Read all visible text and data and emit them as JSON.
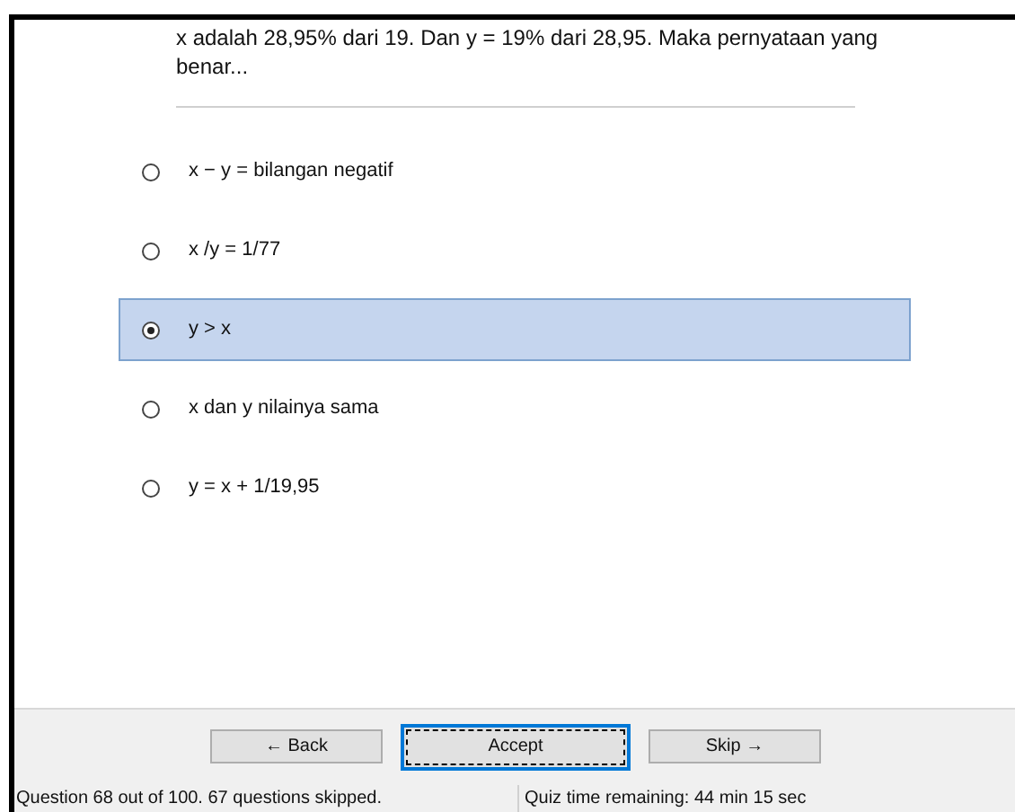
{
  "question": "x adalah 28,95% dari 19.  Dan y = 19% dari 28,95. Maka pernyataan yang benar...",
  "options": [
    {
      "label": "x − y = bilangan negatif",
      "selected": false
    },
    {
      "label": "x /y = 1/77",
      "selected": false
    },
    {
      "label": "y > x",
      "selected": true
    },
    {
      "label": "x dan y nilainya sama",
      "selected": false
    },
    {
      "label": "y = x + 1/19,95",
      "selected": false
    }
  ],
  "buttons": [
    {
      "label": "← Back",
      "focused": false
    },
    {
      "label": "Accept",
      "focused": true
    },
    {
      "label": "Skip →",
      "focused": false
    }
  ],
  "status_bar": {
    "progress": "Question 68 out of 100. 67 questions skipped.",
    "time": "Quiz time remaining: 44 min 15 sec"
  }
}
